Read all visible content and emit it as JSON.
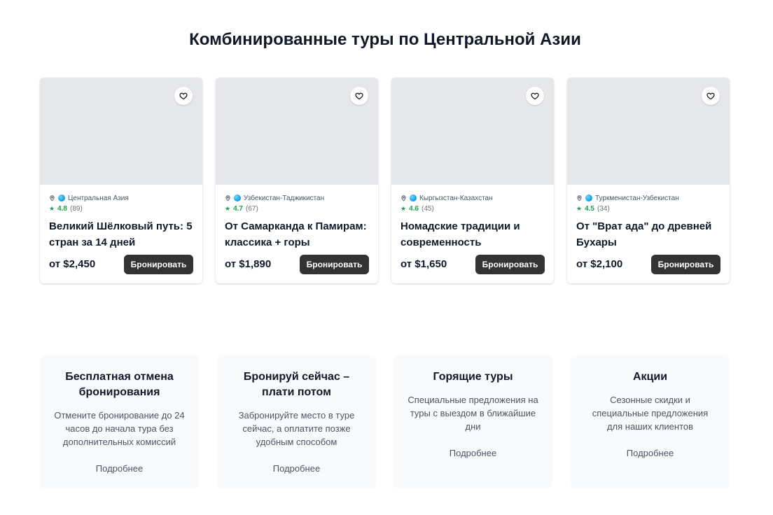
{
  "page": {
    "title": "Комбинированные туры по Центральной Азии"
  },
  "colors": {
    "rating_green": "#16a34a",
    "button_dark": "#333333",
    "image_placeholder": "#e5e7eb",
    "feature_bg": "#f9fafb"
  },
  "tours": [
    {
      "location": "Центральная Азия",
      "rating": "4.8",
      "reviews": "(89)",
      "name": "Великий Шёлковый путь: 5 стран за 14 дней",
      "price": "от $2,450",
      "button": "Бронировать"
    },
    {
      "location": "Узбекистан-Таджикистан",
      "rating": "4.7",
      "reviews": "(67)",
      "name": "От Самарканда к Памирам: классика + горы",
      "price": "от $1,890",
      "button": "Бронировать"
    },
    {
      "location": "Кыргызстан-Казахстан",
      "rating": "4.6",
      "reviews": "(45)",
      "name": "Номадские традиции и современность",
      "price": "от $1,650",
      "button": "Бронировать"
    },
    {
      "location": "Туркменистан-Узбекистан",
      "rating": "4.5",
      "reviews": "(34)",
      "name": "От \"Врат ада\" до древней Бухары",
      "price": "от $2,100",
      "button": "Бронировать"
    }
  ],
  "features": [
    {
      "title": "Бесплатная отмена бронирования",
      "description": "Отмените бронирование до 24 часов до начала тура без дополнительных комиссий",
      "link": "Подробнее"
    },
    {
      "title": "Бронируй сейчас – плати потом",
      "description": "Забронируйте место в туре сейчас, а оплатите позже удобным способом",
      "link": "Подробнее"
    },
    {
      "title": "Горящие туры",
      "description": "Специальные предложения на туры с выездом в ближайшие дни",
      "link": "Подробнее"
    },
    {
      "title": "Акции",
      "description": "Сезонные скидки и специальные предложения для наших клиентов",
      "link": "Подробнее"
    }
  ],
  "icons": {
    "favorite": "heart-icon",
    "location": "map-pin-icon",
    "region": "globe-icon",
    "rating": "star-icon"
  }
}
